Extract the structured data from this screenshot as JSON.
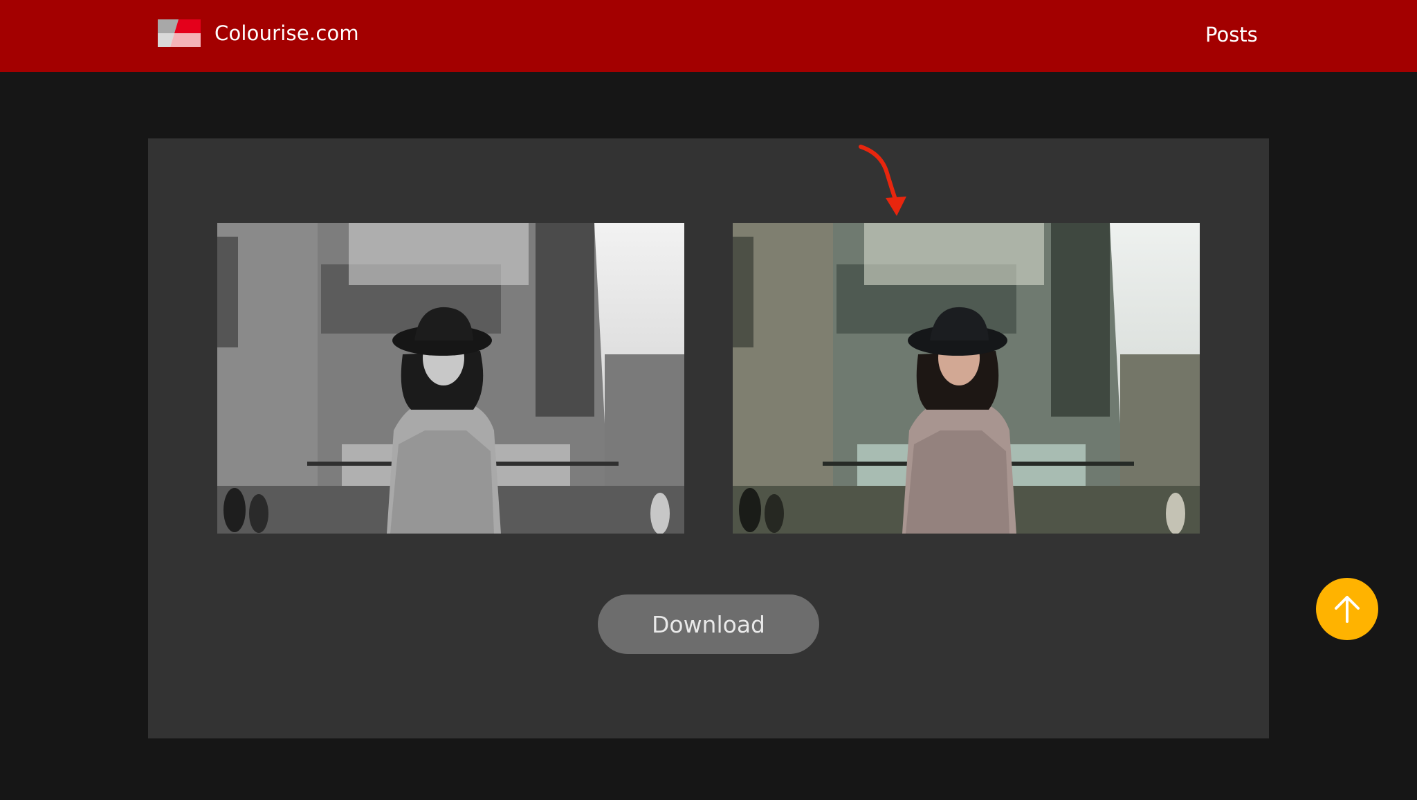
{
  "header": {
    "brand_name": "Colourise.com",
    "nav_link": "Posts",
    "brand_color": "#a30000"
  },
  "main": {
    "original_image_alt": "Black and white photo of a woman in a hat",
    "colourised_image_alt": "Colourised photo of a woman in a hat",
    "download_label": "Download"
  },
  "icons": {
    "logo": "colourise-logo-icon",
    "arrow": "red-arrow-icon",
    "scroll_top": "arrow-up-icon"
  },
  "colors": {
    "page_bg": "#161616",
    "card_bg": "#333333",
    "button_bg": "#6d6d6d",
    "scroll_top_bg": "#ffb300",
    "arrow": "#e8260e"
  }
}
